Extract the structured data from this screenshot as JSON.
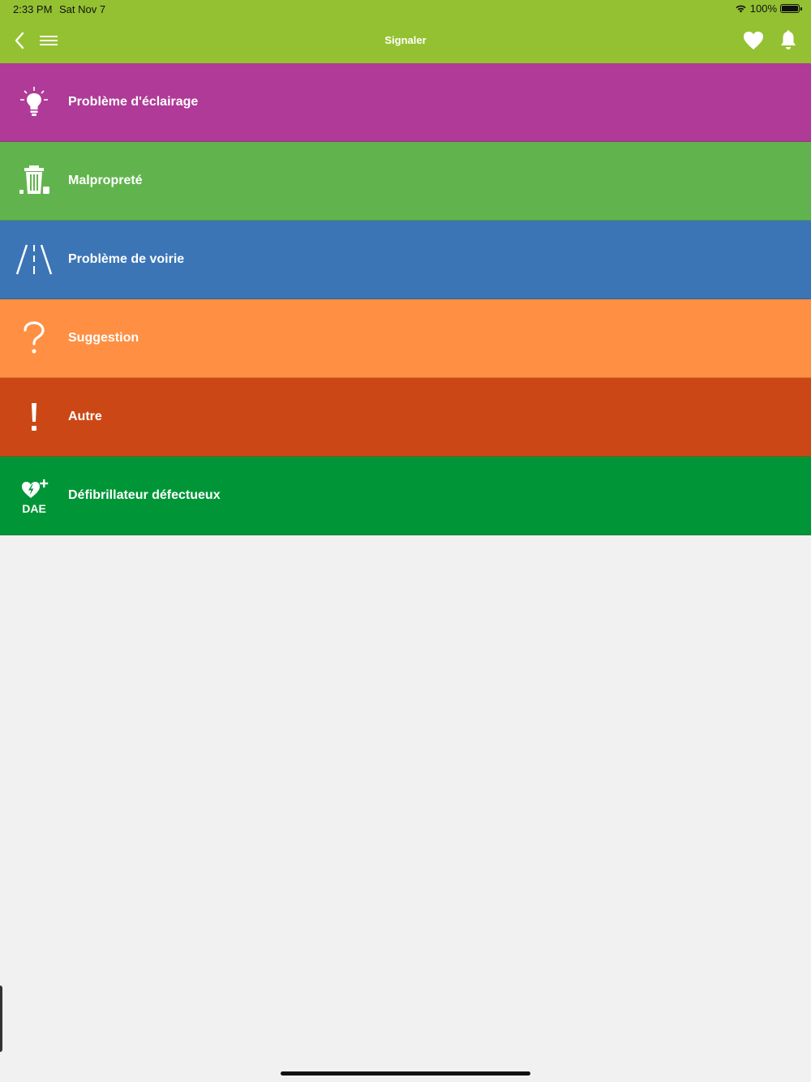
{
  "status_bar": {
    "time": "2:33 PM",
    "date": "Sat Nov 7",
    "battery": "100%"
  },
  "header": {
    "title": "Signaler",
    "back_icon": "chevron-left-icon",
    "menu_icon": "hamburger-menu-icon",
    "favorite_icon": "heart-icon",
    "notification_icon": "bell-icon",
    "color": "#94c131"
  },
  "categories": [
    {
      "label": "Problème d'éclairage",
      "icon": "lightbulb-icon",
      "color": "#b03a97"
    },
    {
      "label": "Malpropreté",
      "icon": "trash-can-icon",
      "color": "#61b44d"
    },
    {
      "label": "Problème de voirie",
      "icon": "road-icon",
      "color": "#3b75b6"
    },
    {
      "label": "Suggestion",
      "icon": "question-mark-icon",
      "color": "#ff8f42"
    },
    {
      "label": "Autre",
      "icon": "exclamation-icon",
      "color": "#cb4816"
    },
    {
      "label": "Défibrillateur défectueux",
      "icon": "defibrillator-icon",
      "color": "#009637",
      "icon_text": "DAE"
    }
  ]
}
